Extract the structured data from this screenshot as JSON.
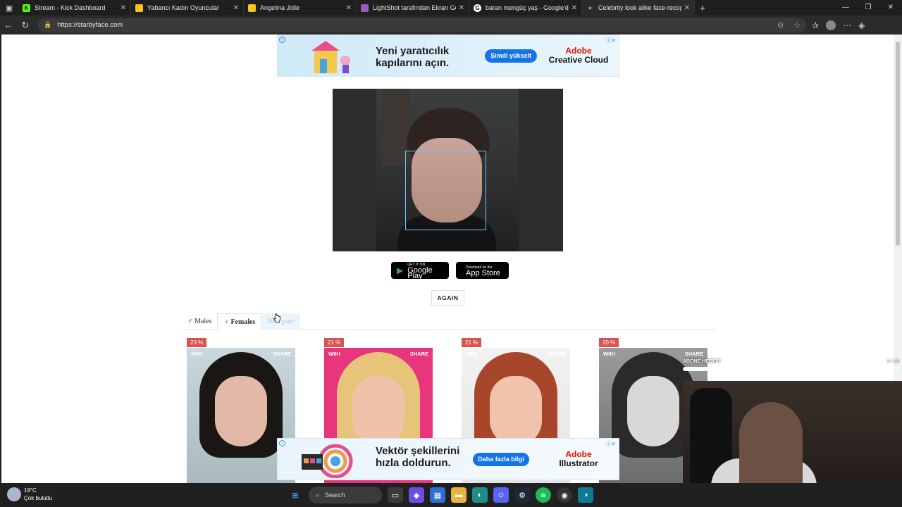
{
  "browser": {
    "tabs": [
      {
        "label": "Stream - Kick Dashboard",
        "fav_color": "#53fc18",
        "fav_text": "K",
        "active": false
      },
      {
        "label": "Yabancı Kadın Oyuncular",
        "fav_color": "#f5c518",
        "fav_text": "",
        "active": false
      },
      {
        "label": "Angelina Jolie",
        "fav_color": "#f5c518",
        "fav_text": "",
        "active": false
      },
      {
        "label": "LightShot tarafından Ekran Görün",
        "fav_color": "#9b59b6",
        "fav_text": "",
        "active": false
      },
      {
        "label": "baran mengüç yaş - Google'da A",
        "fav_color": "#ffffff",
        "fav_text": "G",
        "active": false
      },
      {
        "label": "Celebrity look alike face-recognit",
        "fav_color": "#e08aa0",
        "fav_text": "★",
        "active": true
      }
    ],
    "url": "https://starbyface.com"
  },
  "page": {
    "ad_top": {
      "headline": "Yeni yaratıcılık kapılarını açın.",
      "cta": "Şimdi yükselt",
      "brand_line1": "Adobe",
      "brand_line2": "Creative Cloud"
    },
    "stores": {
      "google_small": "GET IT ON",
      "google_big": "Google Play",
      "apple_small": "Download on the",
      "apple_big": "App Store"
    },
    "again_label": "AGAIN",
    "gender_tabs": [
      {
        "label": "♂ Males",
        "state": "normal"
      },
      {
        "label": "♀ Females",
        "state": "active"
      },
      {
        "label": "Best pair",
        "state": "disabled"
      }
    ],
    "matches": [
      {
        "percent": "23 %",
        "wiki": "WIKI",
        "share": "SHARE"
      },
      {
        "percent": "21 %",
        "wiki": "WIKI",
        "share": "SHARE"
      },
      {
        "percent": "21 %",
        "wiki": "WIKI",
        "share": "SHARE"
      },
      {
        "percent": "20 %",
        "wiki": "WIKI",
        "share": "SHARE"
      }
    ],
    "ad_bottom": {
      "headline": "Vektör şekillerini hızla doldurun.",
      "cta": "Daha fazla bilgi",
      "brand_line1": "Adobe",
      "brand_line2": "Illustrator"
    }
  },
  "stream_overlay": {
    "label": "ABONE HEDEFİ",
    "count": "3 / 20",
    "progress_fraction": 0.15
  },
  "taskbar": {
    "temperature": "19°C",
    "condition": "Çok bulutlu",
    "search_label": "Search"
  }
}
